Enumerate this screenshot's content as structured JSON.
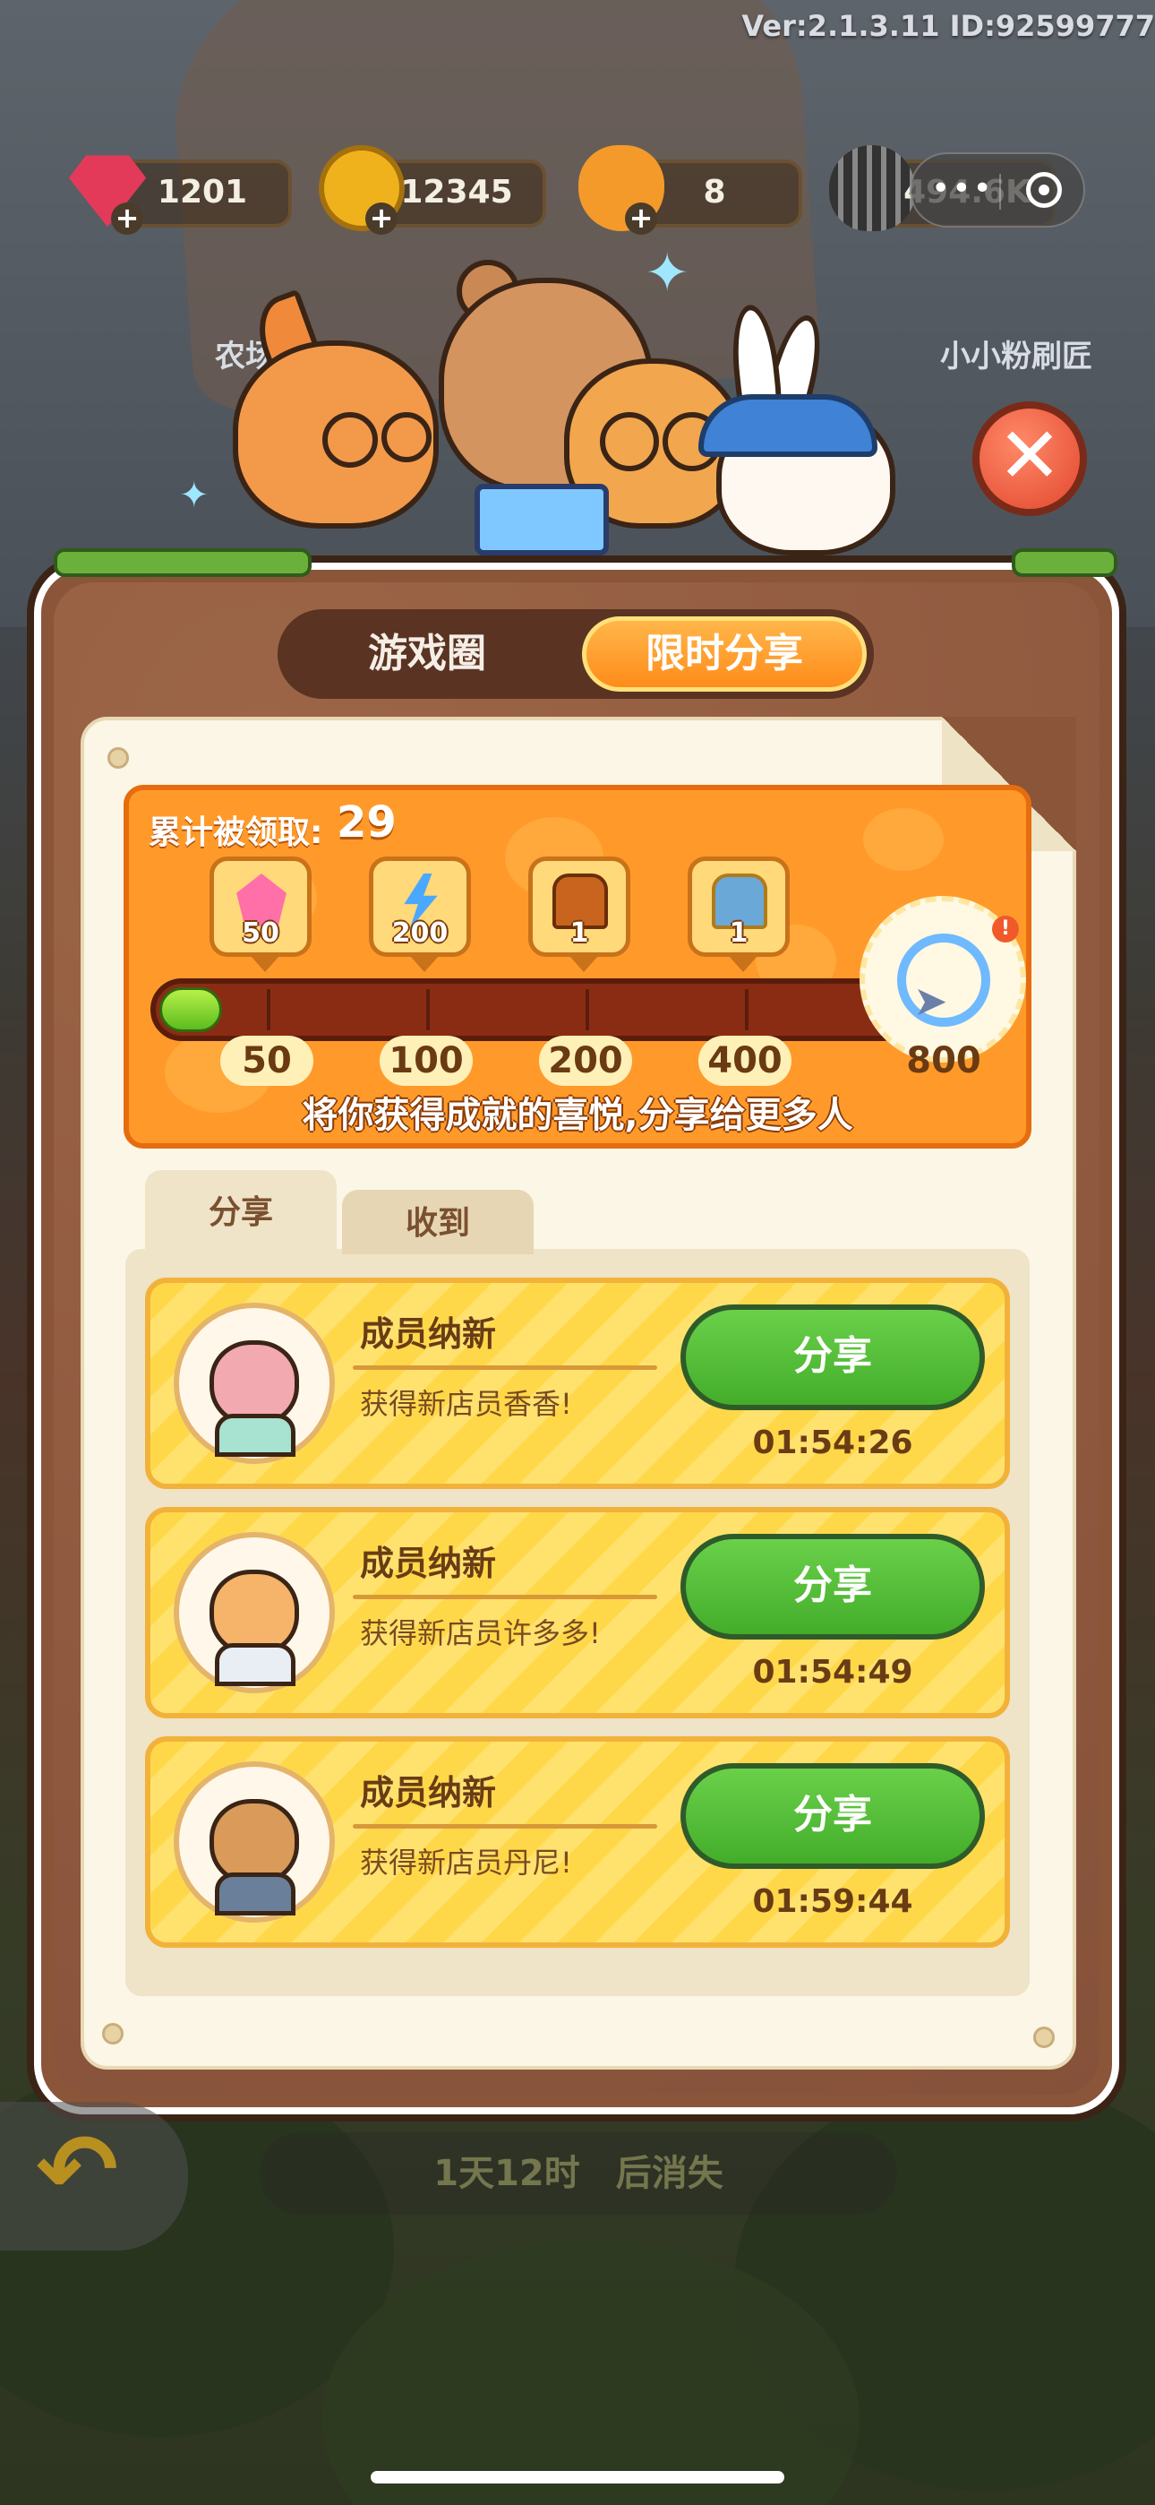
{
  "header": {
    "version_text": "Ver:2.1.3.11 ID:92599777"
  },
  "resources": [
    {
      "name": "gem",
      "value": "1201",
      "color": "#e33a5a"
    },
    {
      "name": "coin",
      "value": "12345",
      "color": "#f0b21c"
    },
    {
      "name": "bee",
      "value": "8",
      "color": "#f39a2a"
    },
    {
      "name": "seed",
      "value": "494.6K",
      "color": "#3a3a3a"
    }
  ],
  "capsule": {
    "dots": "•••"
  },
  "banner": {
    "left_text": "农场",
    "right_text": "小小粉刷匠"
  },
  "close_button": {
    "symbol": "✕"
  },
  "tabs": [
    {
      "label": "游戏圈",
      "active": false
    },
    {
      "label": "限时分享",
      "active": true
    }
  ],
  "progress": {
    "total_label": "累计被领取:",
    "total_value": "29",
    "fill_fraction": 0.036,
    "rewards": [
      {
        "icon": "pink-gem-icon",
        "amount": "50",
        "color": "#ff6fa8"
      },
      {
        "icon": "lightning-icon",
        "amount": "200",
        "color": "#4aa8ff"
      },
      {
        "icon": "wood-chest-icon",
        "amount": "1",
        "color": "#c8641e"
      },
      {
        "icon": "blue-chest-icon",
        "amount": "1",
        "color": "#6aa8d8"
      }
    ],
    "milestones": [
      "50",
      "100",
      "200",
      "400",
      "800"
    ],
    "final_badge": {
      "icon": "paper-plane-ring-icon",
      "alert": "!"
    },
    "subtitle": "将你获得成就的喜悦,分享给更多人"
  },
  "subtabs": [
    {
      "label": "分享",
      "active": true
    },
    {
      "label": "收到",
      "active": false
    }
  ],
  "share_items": [
    {
      "title": "成员纳新",
      "desc": "获得新店员香香!",
      "button": "分享",
      "timer": "01:54:26",
      "avatar": "pig-avatar",
      "color": "#f2a9b0"
    },
    {
      "title": "成员纳新",
      "desc": "获得新店员许多多!",
      "button": "分享",
      "timer": "01:54:49",
      "avatar": "hamster-avatar",
      "color": "#f6b46a"
    },
    {
      "title": "成员纳新",
      "desc": "获得新店员丹尼!",
      "button": "分享",
      "timer": "01:59:44",
      "avatar": "bulb-hamster-avatar",
      "color": "#d99a5a"
    }
  ],
  "footer": {
    "expire_text": "1天12时　后消失"
  }
}
